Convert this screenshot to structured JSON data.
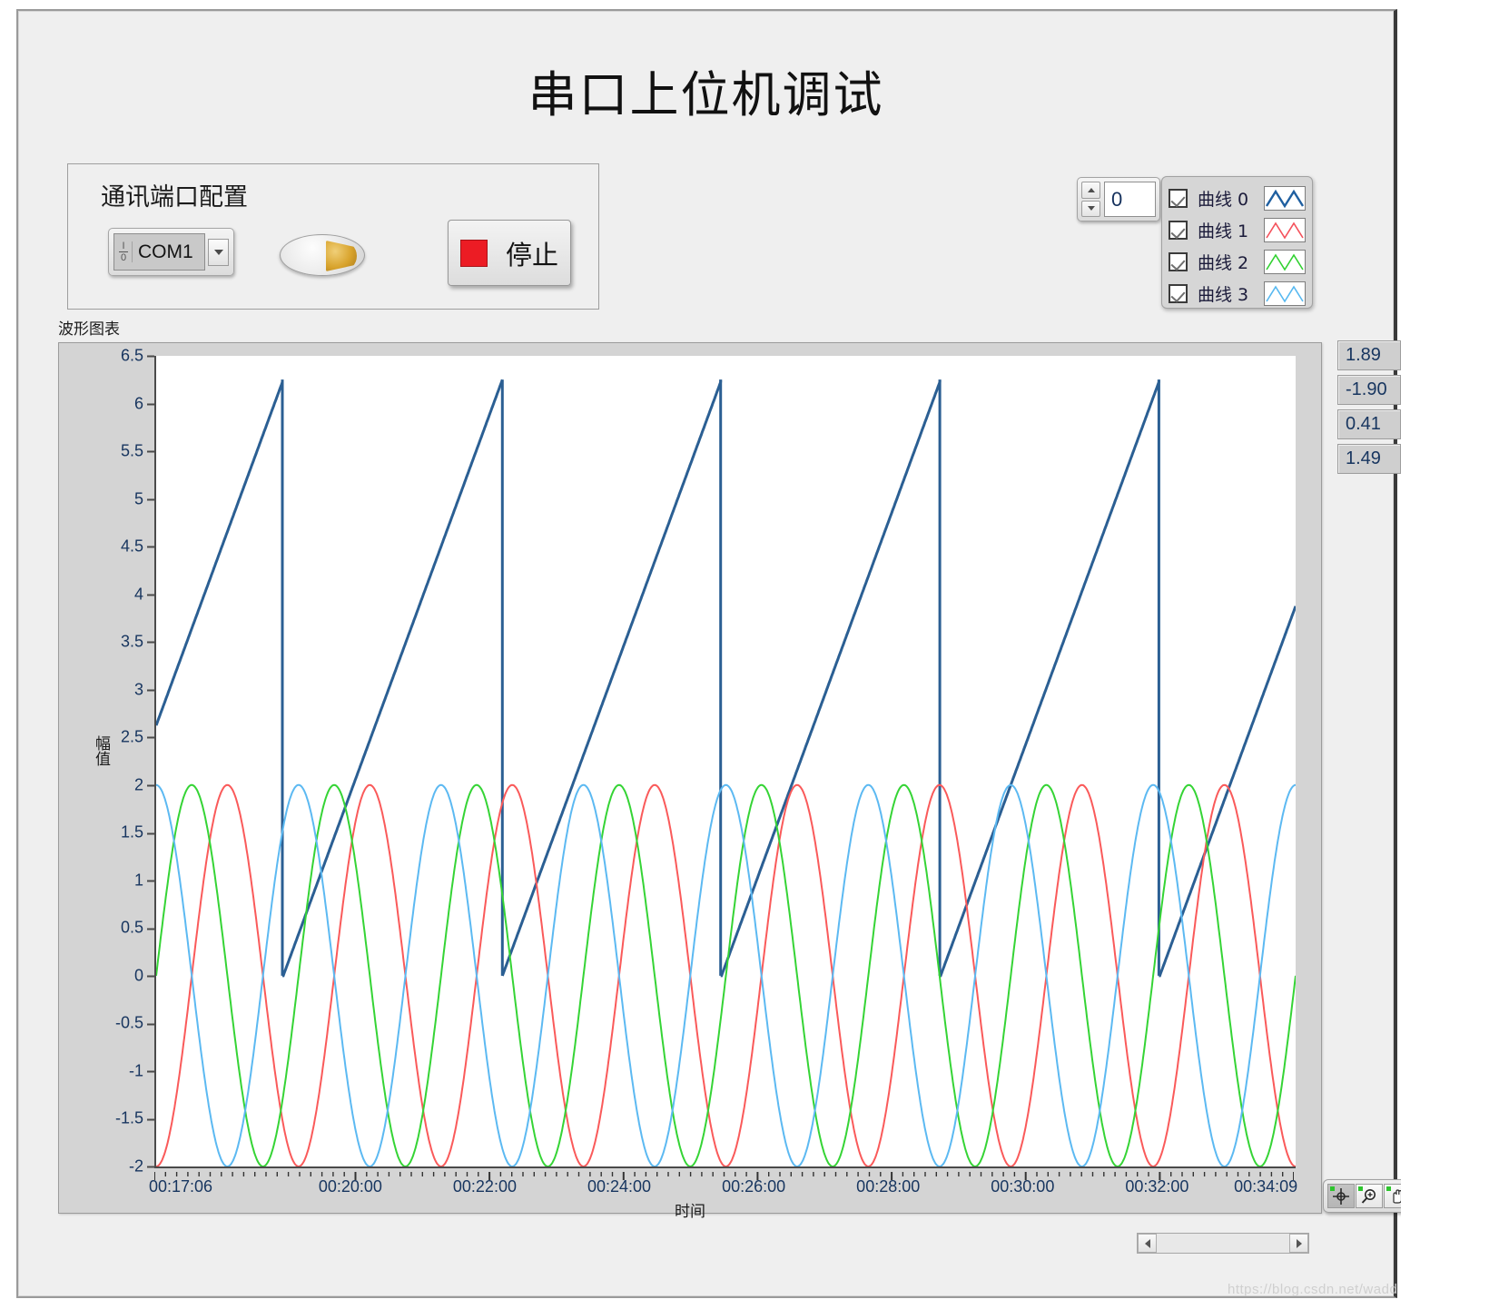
{
  "window": {
    "title": "串口上位机调试"
  },
  "comm_group": {
    "title": "通讯端口配置",
    "port_select": {
      "value": "COM1",
      "io_glyph": "I/O",
      "dropdown_icon": "chevron-down-icon"
    },
    "status_led": {
      "name": "comm-activity-led"
    },
    "stop_button": {
      "label": "停止",
      "led_color": "#ec1c24"
    }
  },
  "spinner": {
    "value": "0",
    "up_icon": "triangle-up-icon",
    "down_icon": "triangle-down-icon"
  },
  "plot_legend": {
    "items": [
      {
        "label": "曲线 0",
        "checked": true,
        "color": "#1f5fa0"
      },
      {
        "label": "曲线 1",
        "checked": true,
        "color": "#f4515b"
      },
      {
        "label": "曲线 2",
        "checked": true,
        "color": "#31d131"
      },
      {
        "label": "曲线 3",
        "checked": true,
        "color": "#56b8f0"
      }
    ]
  },
  "chart_caption": "波形图表",
  "indicators": [
    {
      "name": "value-curve-0",
      "value": "1.89"
    },
    {
      "name": "value-curve-1",
      "value": "-1.90"
    },
    {
      "name": "value-curve-2",
      "value": "0.41"
    },
    {
      "name": "value-curve-3",
      "value": "1.49"
    }
  ],
  "graph_palette": {
    "buttons": [
      {
        "name": "cursor-tool-button",
        "icon": "crosshair-icon",
        "active": true
      },
      {
        "name": "zoom-tool-button",
        "icon": "magnifier-plus-icon",
        "active": false
      },
      {
        "name": "pan-tool-button",
        "icon": "hand-icon",
        "active": false
      }
    ]
  },
  "scrollbar": {
    "left_icon": "arrow-left-icon",
    "right_icon": "arrow-right-icon"
  },
  "watermark": "https://blog.csdn.net/wadd",
  "chart_data": {
    "type": "line",
    "title": "波形图表",
    "xlabel": "时间",
    "ylabel": "幅值",
    "ylim": [
      -2,
      6.5
    ],
    "ytick_labels": [
      "6.5",
      "6",
      "5.5",
      "5",
      "4.5",
      "4",
      "3.5",
      "3",
      "2.5",
      "2",
      "1.5",
      "1",
      "0.5",
      "0",
      "-0.5",
      "-1",
      "-1.5",
      "-2"
    ],
    "ytick_values": [
      6.5,
      6,
      5.5,
      5,
      4.5,
      4,
      3.5,
      3,
      2.5,
      2,
      1.5,
      1,
      0.5,
      0,
      -0.5,
      -1,
      -1.5,
      -2
    ],
    "xtick_labels": [
      "00:17:06",
      "00:20:00",
      "00:22:00",
      "00:24:00",
      "00:26:00",
      "00:28:00",
      "00:30:00",
      "00:32:00",
      "00:34:09"
    ],
    "xlim_labels": [
      "00:17:06",
      "00:34:09"
    ],
    "grid": false,
    "legend_position": "top-right-external",
    "series": [
      {
        "name": "曲线 0",
        "color": "#2b5f93",
        "waveform": "sawtooth",
        "amplitude_min": 0.0,
        "amplitude_max": 6.25,
        "periods": 5.2,
        "phase": 0.42,
        "last_value": 1.89,
        "line_width": 3
      },
      {
        "name": "曲线 1",
        "color": "#fa5a5a",
        "waveform": "sine",
        "amplitude": 2.0,
        "offset": 0.0,
        "periods": 8.0,
        "phase_deg": 180,
        "last_value": -1.9,
        "line_width": 2
      },
      {
        "name": "曲线 2",
        "color": "#35d435",
        "waveform": "sine",
        "amplitude": 2.0,
        "offset": 0.0,
        "periods": 8.0,
        "phase_deg": 270,
        "last_value": 0.41,
        "line_width": 2
      },
      {
        "name": "曲线 3",
        "color": "#5cb9f2",
        "waveform": "sine",
        "amplitude": 2.0,
        "offset": 0.0,
        "periods": 8.0,
        "phase_deg": 0,
        "last_value": 1.49,
        "line_width": 2
      }
    ]
  }
}
